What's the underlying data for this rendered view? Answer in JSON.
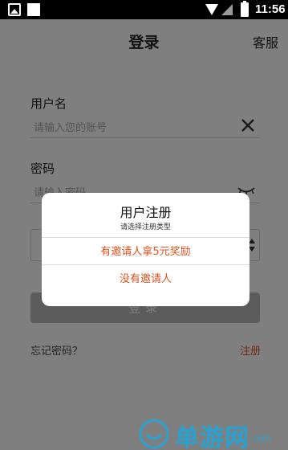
{
  "status_bar": {
    "time": "11:56"
  },
  "header": {
    "title": "登录",
    "service_label": "客服"
  },
  "form": {
    "username_label": "用户名",
    "username_placeholder": "请输入您的账号",
    "password_label": "密码",
    "password_placeholder": "请输入密码",
    "login_label": "登录",
    "forgot_label": "忘记密码？",
    "register_label": "注册"
  },
  "dialog": {
    "title": "用户注册",
    "subtitle": "请选择注册类型",
    "options": [
      "有邀请人拿5元奖励",
      "没有邀请人"
    ]
  },
  "watermark": {
    "text": "单游网",
    "suffix": ".com"
  },
  "colors": {
    "accent": "#e1501d",
    "overlay": "rgba(0,0,0,0.5)",
    "watermark": "#1aa8e0"
  }
}
